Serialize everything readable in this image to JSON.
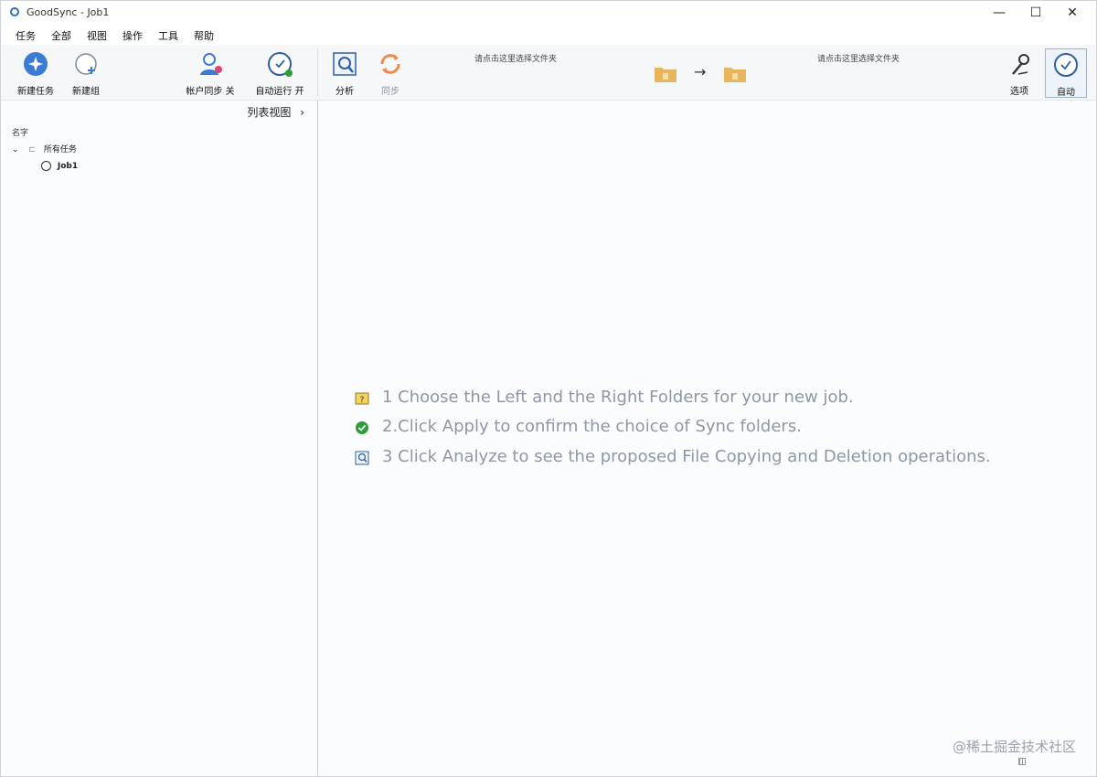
{
  "window": {
    "title": "GoodSync - Job1",
    "minimize": "—",
    "maximize": "☐",
    "close": "✕"
  },
  "menu": [
    "任务",
    "全部",
    "视图",
    "操作",
    "工具",
    "帮助"
  ],
  "toolbar": {
    "new_job": "新建任务",
    "new_group": "新建组",
    "account_sync": "帐户同步 关",
    "auto_run": "自动运行 开",
    "analyze": "分析",
    "sync": "同步",
    "options": "选项",
    "auto": "自动"
  },
  "paths": {
    "left_hint": "请点击这里选择文件夹",
    "right_hint": "请点击这里选择文件夹",
    "arrow": "→"
  },
  "left_pane": {
    "list_view": "列表视图",
    "list_view_arrow": "›",
    "column_name": "名字",
    "group_expand": "⌄",
    "group_name": "所有任务",
    "job_name": "Job1"
  },
  "hints": [
    "1 Choose the Left and the Right Folders for your new job.",
    "2.Click Apply to confirm the choice of Sync folders.",
    "3 Click Analyze to see the proposed File Copying and Deletion operations."
  ],
  "watermark": "@稀土掘金技术社区",
  "colors": {
    "accent_blue": "#3a7bd5",
    "sync_orange": "#f08a4b",
    "folder_yellow": "#e8b45c",
    "check_green": "#2e9e3a",
    "hint_gray": "#8e97a6"
  }
}
